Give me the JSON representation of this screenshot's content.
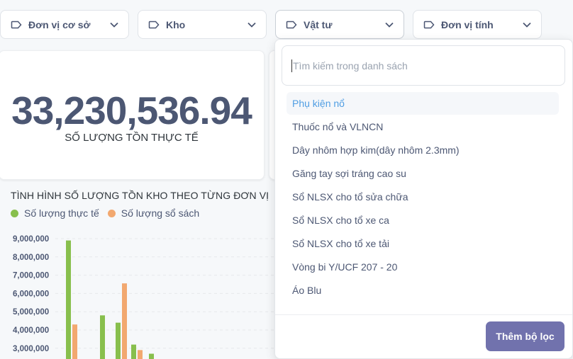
{
  "filters": [
    {
      "label": "Đơn vị cơ sở"
    },
    {
      "label": "Kho"
    },
    {
      "label": "Vật tư"
    },
    {
      "label": "Đơn vị tính"
    }
  ],
  "kpi": {
    "value": "33,230,536.94",
    "label": "SỐ LƯỢNG TỒN THỰC TẾ"
  },
  "chart": {
    "title": "TÌNH HÌNH SỐ LƯỢNG TỒN KHO THEO TỪNG ĐƠN VỊ",
    "legend": [
      {
        "name": "Số lượng thực tế",
        "color": "#88bf4d"
      },
      {
        "name": "Số lượng sổ sách",
        "color": "#f2a86f"
      }
    ]
  },
  "chart_data": {
    "type": "bar",
    "title": "TÌNH HÌNH SỐ LƯỢNG TỒN KHO THEO TỪNG ĐƠN VỊ",
    "yticks": [
      "9,000,000",
      "8,000,000",
      "7,000,000",
      "6,000,000",
      "5,000,000",
      "4,000,000",
      "3,000,000"
    ],
    "series": [
      {
        "name": "Số lượng thực tế",
        "color": "#88bf4d",
        "values": [
          8900000,
          4800000,
          4400000,
          3200000,
          2700000
        ]
      },
      {
        "name": "Số lượng sổ sách",
        "color": "#f2a86f",
        "values": [
          4300000,
          null,
          6550000,
          2900000,
          null
        ]
      }
    ],
    "grid": true,
    "legend_position": "top-left"
  },
  "dropdown": {
    "search_placeholder": "Tìm kiếm trong danh sách",
    "options": [
      "Phụ kiện nổ",
      "Thuốc nổ và VLNCN",
      "Dây nhôm hợp kim(dây nhôm 2.3mm)",
      "Găng tay sợi tráng cao su",
      "Sổ NLSX cho tổ sửa chữa",
      "Sổ NLSX cho tổ xe ca",
      "Sổ NLSX cho tổ xe tải",
      "Vòng bi Y/UCF 207 - 20",
      "Áo Blu"
    ],
    "selected_index": 0,
    "add_button_label": "Thêm bộ lọc"
  }
}
